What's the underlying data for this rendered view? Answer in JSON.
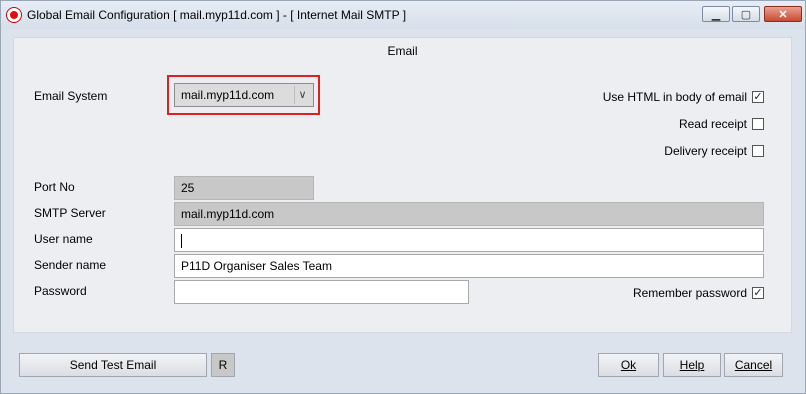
{
  "window": {
    "title": "Global Email Configuration [ mail.myp11d.com ] - [ Internet Mail SMTP ]",
    "min_icon": "minimize-icon",
    "max_icon": "maximize-icon",
    "close_icon": "close-icon"
  },
  "panel": {
    "title": "Email"
  },
  "email_system": {
    "label": "Email System",
    "value": "mail.myp11d.com"
  },
  "options": {
    "html_body": {
      "label": "Use HTML in body of email",
      "checked": true
    },
    "read_receipt": {
      "label": "Read receipt",
      "checked": false
    },
    "delivery_receipt": {
      "label": "Delivery receipt",
      "checked": false
    },
    "remember_password": {
      "label": "Remember password",
      "checked": true
    }
  },
  "fields": {
    "port": {
      "label": "Port No",
      "value": "25"
    },
    "smtp": {
      "label": "SMTP Server",
      "value": "mail.myp11d.com"
    },
    "user": {
      "label": "User name",
      "value": ""
    },
    "sender": {
      "label": "Sender name",
      "value": "P11D Organiser Sales Team"
    },
    "password": {
      "label": "Password",
      "value": ""
    }
  },
  "buttons": {
    "send_test": "Send Test Email",
    "r": "R",
    "ok": "Ok",
    "help": "Help",
    "cancel": "Cancel"
  },
  "colors": {
    "highlight": "#e02020",
    "window_bg": "#dde3ec",
    "panel_bg": "#eceef1"
  }
}
